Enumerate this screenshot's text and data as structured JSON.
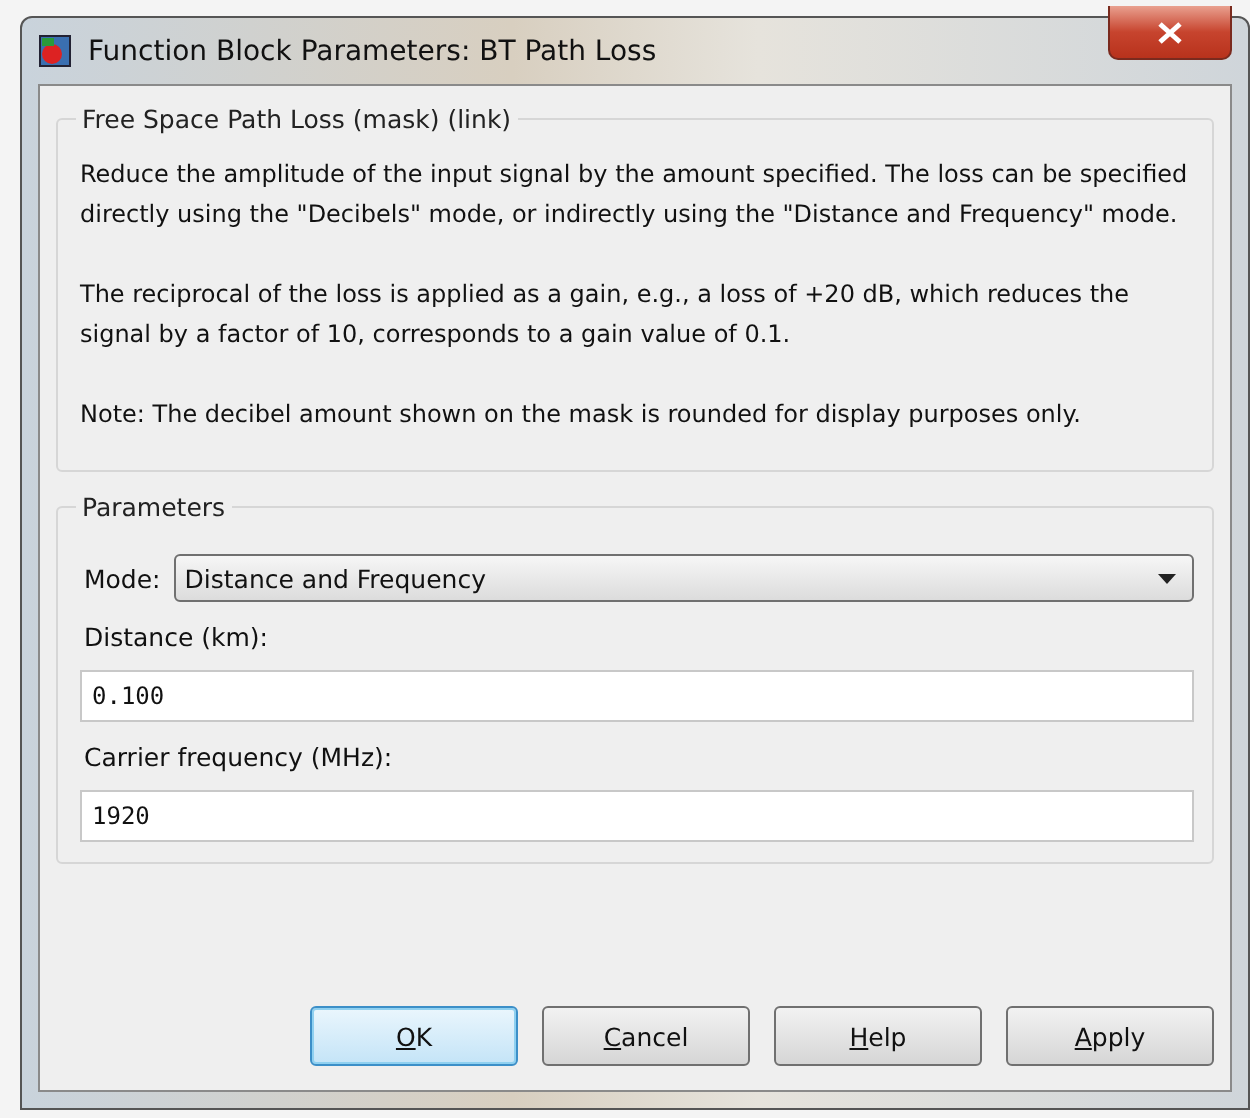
{
  "window": {
    "title": "Function Block Parameters: BT Path Loss"
  },
  "description": {
    "title": "Free Space Path Loss (mask) (link)",
    "paragraphs": [
      "Reduce the amplitude of the input signal by the amount specified.  The loss can be specified directly using the \"Decibels\" mode, or indirectly using the \"Distance and Frequency\" mode.",
      "The reciprocal of the loss is applied as a gain, e.g., a loss of +20 dB, which reduces the signal by a factor of 10, corresponds to a gain value of 0.1.",
      "Note:  The decibel amount shown on the mask is rounded for display purposes only."
    ]
  },
  "parameters": {
    "title": "Parameters",
    "mode": {
      "label": "Mode:",
      "value": "Distance and Frequency"
    },
    "fields": [
      {
        "label": "Distance (km):",
        "value": "0.100"
      },
      {
        "label": "Carrier frequency (MHz):",
        "value": "1920"
      }
    ]
  },
  "buttons": [
    {
      "accel": "O",
      "rest": "K",
      "default": true
    },
    {
      "accel": "C",
      "rest": "ancel",
      "default": false
    },
    {
      "accel": "H",
      "rest": "elp",
      "default": false
    },
    {
      "accel": "A",
      "rest": "pply",
      "default": false
    }
  ]
}
